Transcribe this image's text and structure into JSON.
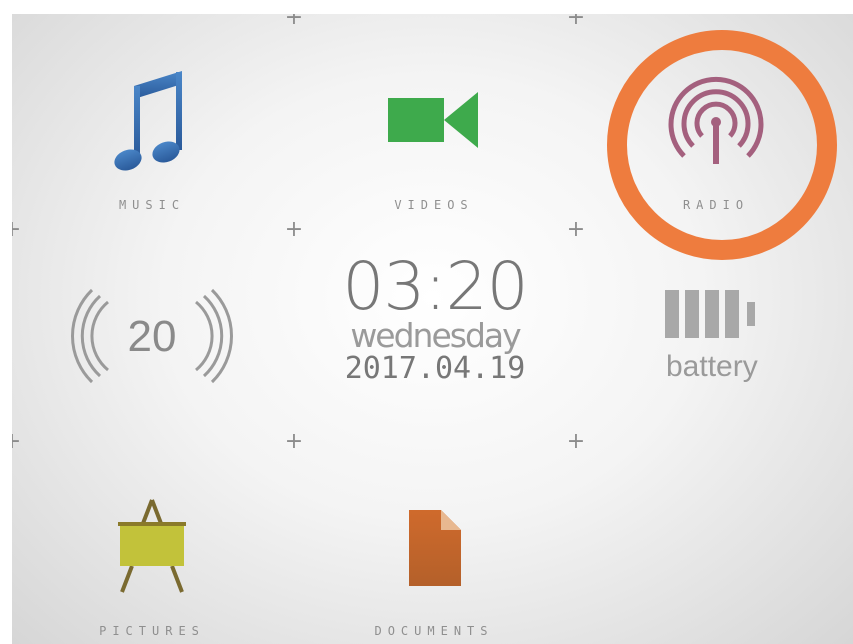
{
  "tiles": {
    "music": {
      "label": "MUSIC",
      "icon": "music-note-icon",
      "color": "#3a6db0"
    },
    "videos": {
      "label": "VIDEOS",
      "icon": "video-camera-icon",
      "color": "#3aa84a"
    },
    "radio": {
      "label": "RADIO",
      "icon": "radio-antenna-icon",
      "color": "#a05a7a",
      "highlighted": true,
      "highlight_color": "#ee7c3e"
    },
    "pictures": {
      "label": "PICTURES",
      "icon": "easel-icon",
      "color": "#b8b830"
    },
    "documents": {
      "label": "DOCUMENTS",
      "icon": "document-icon",
      "color": "#c0602a"
    }
  },
  "signal": {
    "value": "20",
    "icon": "signal-icon"
  },
  "clock": {
    "time": "03:20",
    "day": "wednesday",
    "date": "2017.04.19"
  },
  "battery": {
    "label": "battery",
    "icon": "battery-icon",
    "level_bars": 4,
    "level_fraction": 1.0
  }
}
